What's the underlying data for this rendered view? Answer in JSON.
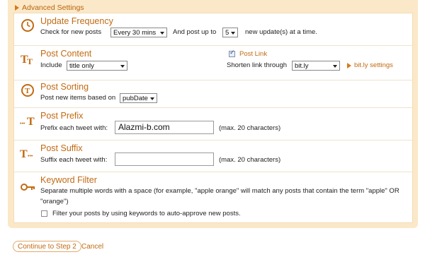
{
  "advanced_settings": {
    "label": "Advanced Settings"
  },
  "update_frequency": {
    "title": "Update Frequency",
    "check_label": "Check for new posts",
    "frequency_value": "Every 30 mins",
    "post_up_to_label": "And post up to",
    "count_value": "5",
    "suffix_label": "new update(s) at a time."
  },
  "post_content": {
    "title": "Post Content",
    "include_label": "Include",
    "include_value": "title only",
    "post_link_label": "Post Link",
    "post_link_checked": true,
    "shorten_label": "Shorten link through",
    "shorten_value": "bit.ly",
    "settings_link": "bit.ly settings"
  },
  "post_sorting": {
    "title": "Post Sorting",
    "label": "Post new items based on",
    "value": "pubDate"
  },
  "post_prefix": {
    "title": "Post Prefix",
    "label": "Prefix each tweet with:",
    "value": "Alazmi-b.com",
    "hint": "(max. 20 characters)"
  },
  "post_suffix": {
    "title": "Post Suffix",
    "label": "Suffix each tweet with:",
    "value": "",
    "hint": "(max. 20 characters)"
  },
  "keyword_filter": {
    "title": "Keyword Filter",
    "description_line1": "Separate multiple words with a space (for example, \"apple orange\" will match any posts that contain the term \"apple\" OR",
    "description_line2": "\"orange\")",
    "checkbox_label": "Filter your posts by using keywords to auto-approve new posts.",
    "checkbox_checked": false
  },
  "footer": {
    "continue_label": "Continue to Step 2",
    "cancel_label": "Cancel"
  },
  "colors": {
    "accent": "#c26a12",
    "outer_bg": "#fbe8c8",
    "border": "#f3dcb4"
  }
}
